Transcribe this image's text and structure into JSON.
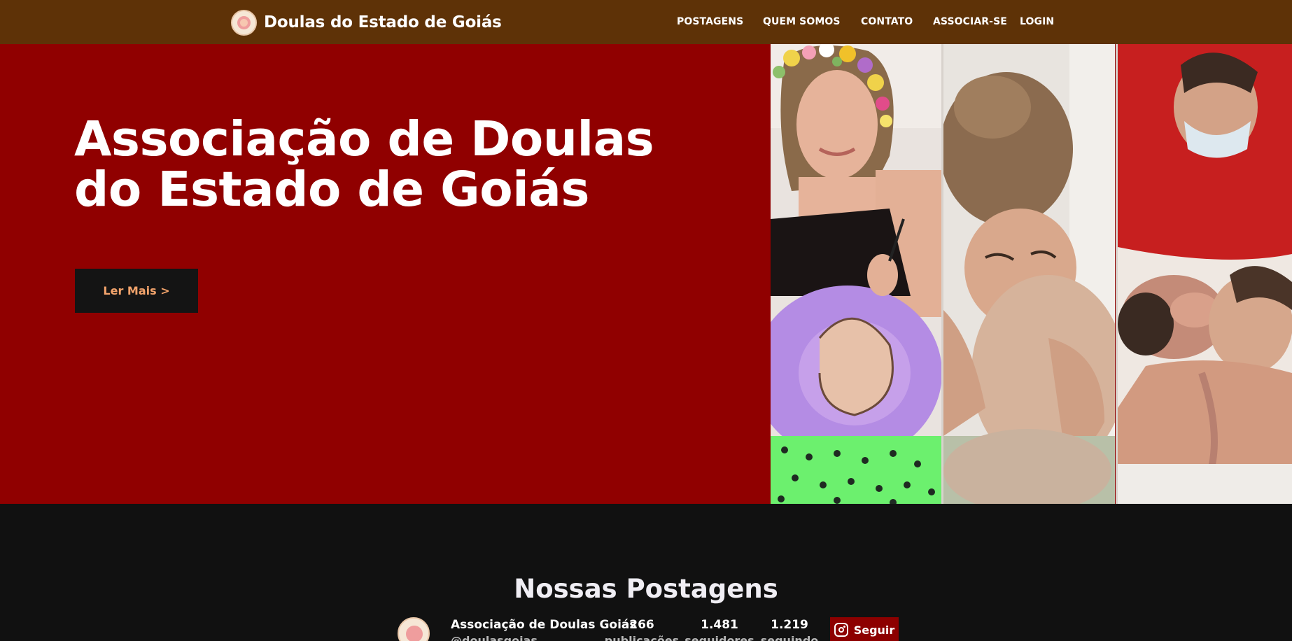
{
  "header": {
    "brand_title": "Doulas do Estado de Goiás",
    "logo_icon": "doula-logo-icon",
    "nav": [
      {
        "label": "POSTAGENS"
      },
      {
        "label": "QUEM SOMOS"
      },
      {
        "label": "CONTATO"
      },
      {
        "label": "ASSOCIAR-SE"
      },
      {
        "label": "LOGIN"
      }
    ],
    "colors": {
      "background": "#5e3207",
      "text": "#ffffff"
    }
  },
  "hero": {
    "title_line1": "Associação de Doulas",
    "title_line2": "do Estado de Goiás",
    "button_label": "Ler Mais >",
    "colors": {
      "background": "#900000",
      "button_bg": "#141414",
      "button_text": "#f3a46c"
    },
    "photos": [
      "pregnant-woman-painted-belly-photo",
      "woman-embracing-photo",
      "mother-newborn-birth-photo"
    ]
  },
  "posts": {
    "title": "Nossas Postagens",
    "instagram": {
      "account_name": "Associação de Doulas Goiás",
      "handle": "@doulasgoias",
      "stats": [
        {
          "value": "266",
          "label": "publicações"
        },
        {
          "value": "1.481",
          "label": "seguidores"
        },
        {
          "value": "1.219",
          "label": "seguindo"
        }
      ],
      "follow_label": "Seguir",
      "follow_icon": "instagram-icon"
    }
  }
}
